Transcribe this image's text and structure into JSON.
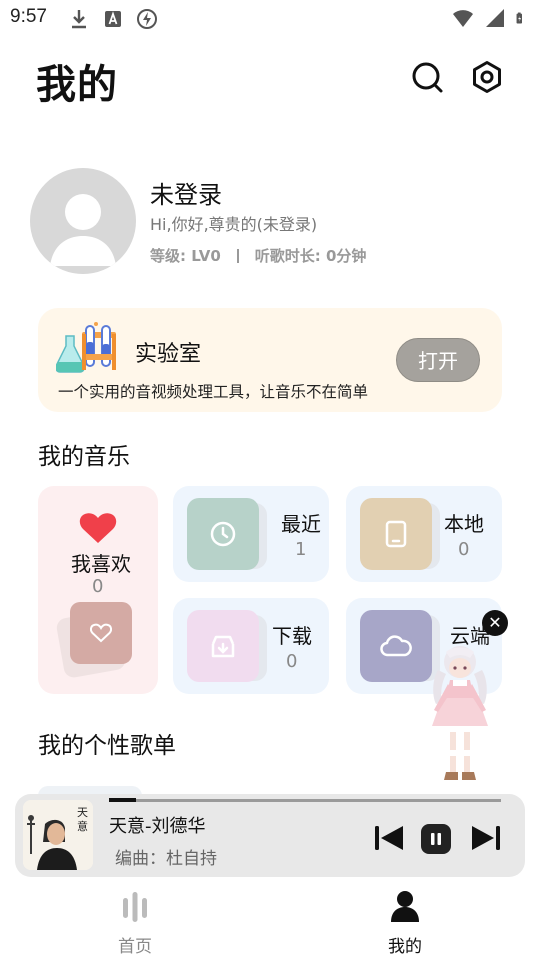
{
  "status_bar": {
    "time": "9:57"
  },
  "header": {
    "title": "我的"
  },
  "profile": {
    "name": "未登录",
    "greeting": "Hi,你好,尊贵的(未登录)",
    "level": "等级: LV0",
    "listen_time": "听歌时长: 0分钟"
  },
  "lab": {
    "title": "实验室",
    "description": "一个实用的音视频处理工具，让音乐不在简单",
    "open_label": "打开"
  },
  "my_music": {
    "title": "我的音乐",
    "favorites": {
      "label": "我喜欢",
      "count": "0"
    },
    "recent": {
      "label": "最近",
      "count": "1"
    },
    "local": {
      "label": "本地",
      "count": "0"
    },
    "download": {
      "label": "下载",
      "count": "0"
    },
    "cloud": {
      "label": "云端"
    }
  },
  "playlists": {
    "title": "我的个性歌单"
  },
  "player": {
    "song_title": "天意-刘德华",
    "subtitle": "编曲：杜自持",
    "cover_text": "天意",
    "progress": 0.07
  },
  "bottom_nav": {
    "home": "首页",
    "mine": "我的"
  },
  "colors": {
    "lab_bg": "#fff7ea",
    "fav_bg": "#fdeff0",
    "tile_bg": "#eef5fd",
    "heart": "#f0404a",
    "recent_cover": "#b7d2c9",
    "local_cover": "#e2d0b2",
    "download_cover": "#f1dcef",
    "cloud_cover": "#a7a6c8",
    "fav_cover": "#d4aaa4"
  }
}
